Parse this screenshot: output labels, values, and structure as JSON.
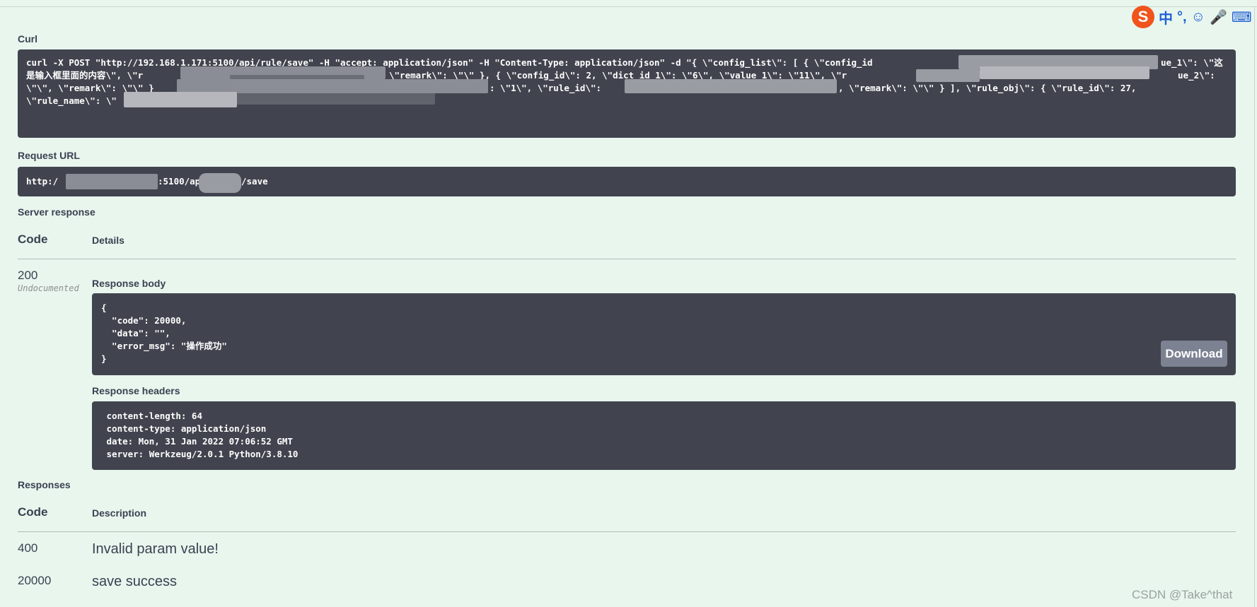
{
  "curl": {
    "label": "Curl",
    "lines": [
      "curl -X POST \"http://192.168.1.171:5100/api/rule/save\" -H \"accept: application/json\" -H \"Content-Type: application/json\" -d \"{ \\\"config_list\\\": [ { \\\"config_id",
      "ue_1\\\": \\\"这",
      "是输入框里面的内容\\\", \\\"r",
      "\\\"remark\\\": \\\"\\\" }, { \\\"config_id\\\": 2, \\\"dict_id_1\\\": \\\"6\\\", \\\"value_1\\\": \\\"11\\\", \\\"r",
      "ue_2\\\":",
      "\\\"\\\", \\\"remark\\\": \\\"\\\" }",
      ": \\\"1\\\", \\\"rule_id\\\":",
      ", \\\"remark\\\": \\\"\\\" } ], \\\"rule_obj\\\": { \\\"rule_id\\\": 27,",
      "\\\"rule_name\\\": \\\""
    ]
  },
  "request_url": {
    "label": "Request URL",
    "prefix": "http:/",
    "middle": ":5100/api",
    "suffix": "/save"
  },
  "server_response": {
    "label": "Server response",
    "col_code": "Code",
    "col_details": "Details",
    "code": "200",
    "undocumented": "Undocumented",
    "body_label": "Response body",
    "body_lines": [
      "{",
      "  \"code\": 20000,",
      "  \"data\": \"\",",
      "  \"error_msg\": \"操作成功\"",
      "}"
    ],
    "download_label": "Download",
    "headers_label": "Response headers",
    "header_lines": [
      " content-length: 64",
      " content-type: application/json",
      " date: Mon, 31 Jan 2022 07:06:52 GMT",
      " server: Werkzeug/2.0.1 Python/3.8.10"
    ]
  },
  "responses": {
    "label": "Responses",
    "col_code": "Code",
    "col_description": "Description",
    "rows": [
      {
        "code": "400",
        "description": "Invalid param value!"
      },
      {
        "code": "20000",
        "description": "save success"
      }
    ]
  },
  "ime": {
    "logo": "S",
    "items": [
      "中",
      "°,",
      "☺",
      "🎤",
      "⌨"
    ]
  },
  "watermark": "CSDN @Take^that",
  "colors": {
    "page_bg": "#e8f6ee",
    "code_bg": "#41444e",
    "download_bg": "#7d8293",
    "ime_orange": "#f0531c",
    "ime_blue": "#1f5fd6"
  }
}
